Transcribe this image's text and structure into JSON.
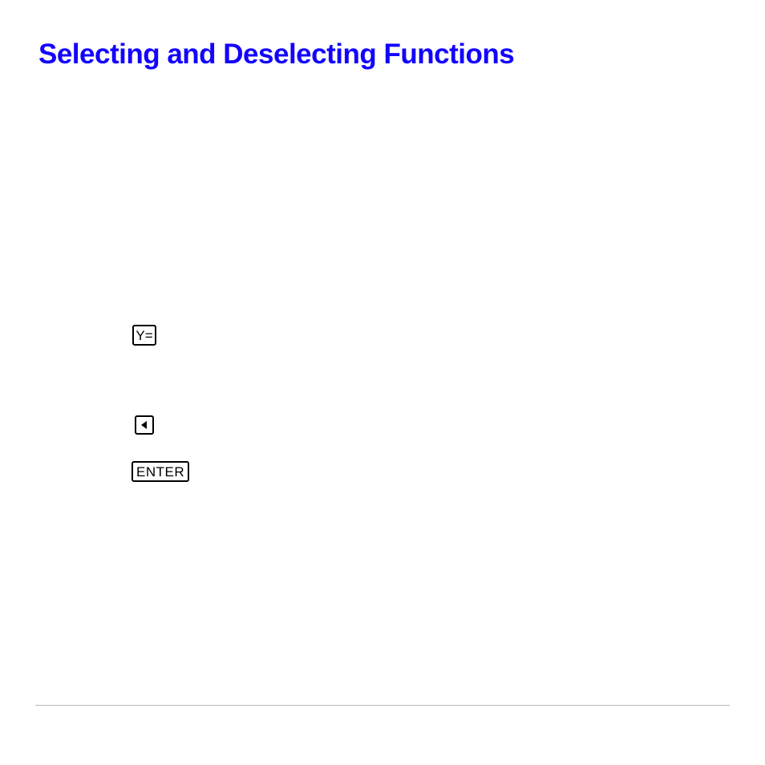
{
  "title": "Selecting and Deselecting Functions",
  "keys": {
    "y_equals": "Y=",
    "enter": "ENTER"
  }
}
